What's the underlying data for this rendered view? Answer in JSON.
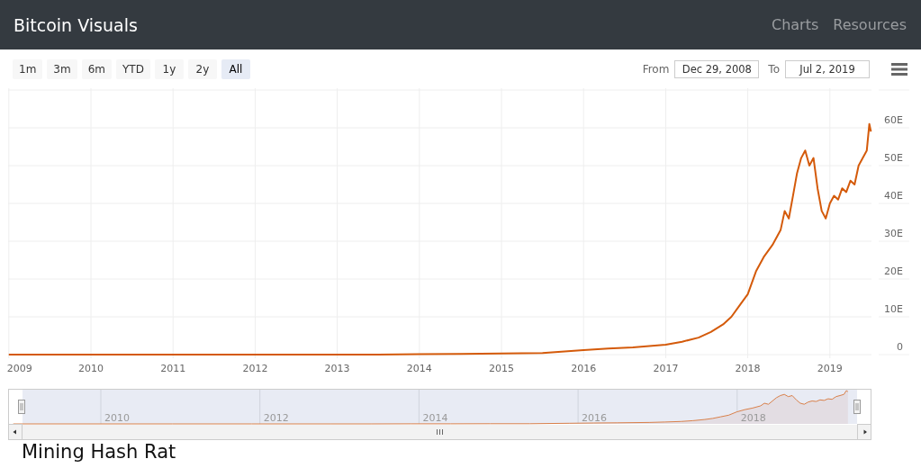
{
  "header": {
    "title": "Bitcoin Visuals",
    "nav": [
      {
        "label": "Charts"
      },
      {
        "label": "Resources"
      }
    ]
  },
  "range_buttons": [
    {
      "label": "1m",
      "selected": false
    },
    {
      "label": "3m",
      "selected": false
    },
    {
      "label": "6m",
      "selected": false
    },
    {
      "label": "YTD",
      "selected": false
    },
    {
      "label": "1y",
      "selected": false
    },
    {
      "label": "2y",
      "selected": false
    },
    {
      "label": "All",
      "selected": true
    }
  ],
  "date_range": {
    "from_label": "From",
    "from": "Dec 29, 2008",
    "to_label": "To",
    "to": "Jul 2, 2019"
  },
  "chart": {
    "chart_data": {
      "type": "line",
      "x": [
        2009,
        2010,
        2011,
        2012,
        2013,
        2013.5,
        2014,
        2014.5,
        2015,
        2015.5,
        2016,
        2016.3,
        2016.6,
        2017,
        2017.2,
        2017.4,
        2017.55,
        2017.7,
        2017.8,
        2017.9,
        2018,
        2018.1,
        2018.2,
        2018.3,
        2018.4,
        2018.45,
        2018.5,
        2018.55,
        2018.6,
        2018.65,
        2018.7,
        2018.75,
        2018.8,
        2018.85,
        2018.9,
        2018.95,
        2019,
        2019.05,
        2019.1,
        2019.15,
        2019.2,
        2019.25,
        2019.3,
        2019.35,
        2019.4,
        2019.45,
        2019.48,
        2019.5
      ],
      "series": [
        {
          "color": "#d45a0a",
          "values": [
            0,
            0,
            0,
            0,
            0,
            0,
            0.1,
            0.2,
            0.3,
            0.4,
            1.2,
            1.6,
            1.9,
            2.6,
            3.4,
            4.5,
            6,
            8,
            10,
            13,
            16,
            22,
            26,
            29,
            33,
            38,
            36,
            42,
            48,
            52,
            54,
            50,
            52,
            44,
            38,
            36,
            40,
            42,
            41,
            44,
            43,
            46,
            45,
            50,
            52,
            54,
            61,
            59
          ]
        }
      ],
      "xlim": [
        2009,
        2019.5
      ],
      "ylim": [
        0,
        70
      ],
      "grid": true,
      "xticks": [
        2009,
        2010,
        2011,
        2012,
        2013,
        2014,
        2015,
        2016,
        2017,
        2018,
        2019
      ],
      "yticks": [
        {
          "value": 0,
          "label": "0"
        },
        {
          "value": 10,
          "label": "10E"
        },
        {
          "value": 20,
          "label": "20E"
        },
        {
          "value": 30,
          "label": "30E"
        },
        {
          "value": 40,
          "label": "40E"
        },
        {
          "value": 50,
          "label": "50E"
        },
        {
          "value": 60,
          "label": "60E"
        }
      ]
    }
  },
  "navigator": {
    "labels": [
      {
        "label": "2010"
      },
      {
        "label": "2012"
      },
      {
        "label": "2014"
      },
      {
        "label": "2016"
      },
      {
        "label": "2018"
      }
    ]
  },
  "section_heading": "Mining Hash Rat"
}
